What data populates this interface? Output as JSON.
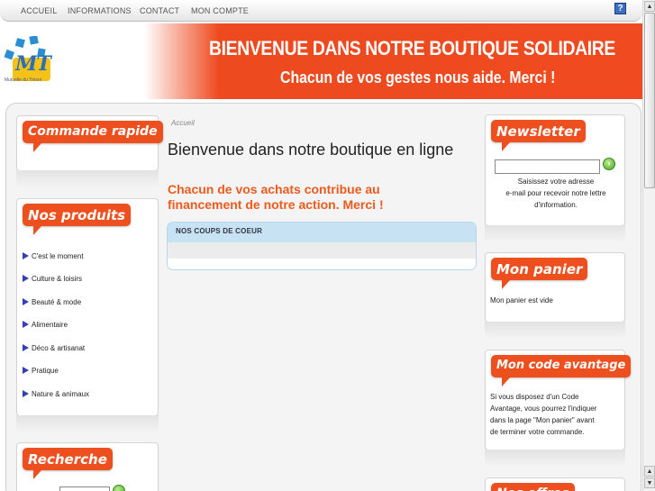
{
  "topnav": {
    "items": [
      "ACCUEIL",
      "INFORMATIONS",
      "CONTACT",
      "MON COMPTE"
    ],
    "help": "?"
  },
  "logo": {
    "letters": "MT",
    "caption": "Mutuelle du Trésor"
  },
  "banner": {
    "title": "BIENVENUE DANS NOTRE BOUTIQUE SOLIDAIRE",
    "subtitle": "Chacun de vos gestes nous aide. Merci !",
    "color": "#ee4a1f"
  },
  "left": {
    "commande_rapide": "Commande rapide",
    "nos_produits": "Nos produits",
    "products": [
      "C'est le moment",
      "Culture & loisirs",
      "Beauté & mode",
      "Alimentaire",
      "Déco & artisanat",
      "Pratique",
      "Nature & animaux"
    ],
    "recherche": "Recherche"
  },
  "center": {
    "breadcrumb": "Accueil",
    "title": "Bienvenue dans notre boutique en ligne",
    "subtitle": "Chacun de vos achats contribue au financement de notre action. Merci !",
    "coups_de_coeur": "NOS COUPS DE COEUR"
  },
  "right": {
    "newsletter": "Newsletter",
    "newsletter_text": [
      "Saisissez votre adresse",
      "e-mail pour recevoir notre lettre",
      "d'information."
    ],
    "panier": "Mon panier",
    "panier_text": "Mon panier est vide",
    "code": "Mon code avantage",
    "code_text": [
      "Si vous disposez d'un Code",
      "Avantage, vous pourrez l'indiquer",
      "dans la page \"Mon panier\" avant",
      "de terminer votre commande."
    ],
    "next_box_partial": "Nos offres"
  },
  "colors": {
    "accent": "#ee4f1f",
    "link_triangle": "#3340b8",
    "table_head": "#c6e2f3"
  }
}
